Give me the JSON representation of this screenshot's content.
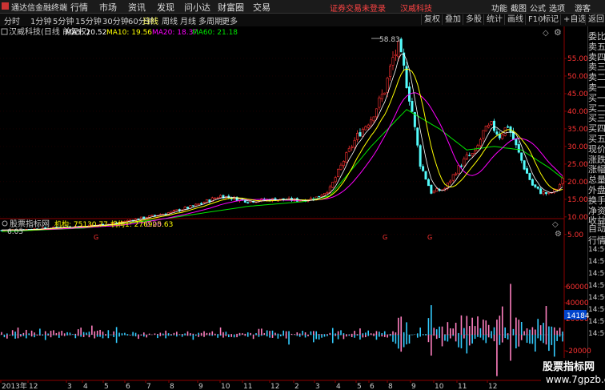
{
  "app": {
    "title": "通达信金融终端",
    "logo_color": "#cc3333"
  },
  "menu": [
    "行情",
    "市场",
    "资讯",
    "发现",
    "问小达",
    "财富圈",
    "交易"
  ],
  "warning": "证券交易未登录",
  "stock_name": "汉威科技",
  "right_menu": [
    "功能",
    "截图",
    "公式",
    "选项",
    "游客"
  ],
  "periods": [
    "分时",
    "1分钟",
    "5分钟",
    "15分钟",
    "30分钟",
    "60分钟",
    "日线",
    "周线",
    "月线",
    "多周期",
    "更多"
  ],
  "active_period": "日线",
  "tool_buttons": [
    "复权",
    "叠加",
    "多股",
    "统计",
    "画线",
    "F10",
    "标记",
    "+自选",
    "返回"
  ],
  "info": {
    "title": "汉威科技(日线 前复权)",
    "ma5": "MA5: 20.52",
    "ma10": "MA10: 19.56",
    "ma20": "MA20: 18.37",
    "ma60": "MA60: 21.18"
  },
  "indicator": {
    "name": "股票指标网",
    "v1": "机构: 75130.77",
    "v2": "机构1: 276925.63",
    "v3": ": 0.00"
  },
  "right_panel": {
    "top": [
      "委比",
      "卖五",
      "卖四",
      "卖三",
      "卖二",
      "卖一",
      "买一",
      "买二",
      "买三",
      "买四",
      "买五",
      "现价",
      "涨跌",
      "涨幅",
      "总量",
      "外盘",
      "换手",
      "净资",
      "收益"
    ],
    "bottom": [
      "自动",
      "行情",
      "14:50",
      "14:50",
      "14:50",
      "14:50",
      "14:50",
      "14:50",
      "14:50",
      "14:50"
    ]
  },
  "price_axis": [
    "55.00",
    "50.00",
    "45.00",
    "40.00",
    "35.00",
    "30.00",
    "25.00",
    "20.00",
    "15.00",
    "10.00",
    "5.00"
  ],
  "indicator_axis": [
    "60000",
    "40000",
    "20000",
    "-20000"
  ],
  "current_label": "14184",
  "max_label": "58.83",
  "min_label": "6.05",
  "x_labels": [
    "2013年",
    "12",
    "3",
    "4",
    "5",
    "6",
    "7",
    "8",
    "9",
    "10",
    "11",
    "12",
    "2",
    "3",
    "4",
    "5",
    "6",
    "8",
    "9",
    "10",
    "11",
    "12"
  ],
  "watermark": {
    "line1": "股票指标网",
    "line2": "www.7gpzb.com"
  },
  "colors": {
    "up": "#ff3232",
    "down": "#54fcfc",
    "ma5": "#ffffff",
    "ma10": "#ffff00",
    "ma20": "#ff00ff",
    "ma60": "#00e600",
    "pink": "#ff7fbf",
    "cyan": "#33ccff"
  },
  "chart_data": {
    "type": "candlestick",
    "ylim": [
      4.5,
      60
    ],
    "price_path": [
      [
        0,
        6.2
      ],
      [
        10,
        6.5
      ],
      [
        20,
        7
      ],
      [
        30,
        7.4
      ],
      [
        40,
        8
      ],
      [
        50,
        9.5
      ],
      [
        60,
        11
      ],
      [
        70,
        13
      ],
      [
        80,
        16
      ],
      [
        90,
        14.5
      ],
      [
        100,
        15
      ],
      [
        110,
        14.7
      ],
      [
        115,
        15.5
      ],
      [
        120,
        18
      ],
      [
        125,
        26
      ],
      [
        130,
        33
      ],
      [
        135,
        38
      ],
      [
        140,
        46
      ],
      [
        143,
        55
      ],
      [
        145,
        58
      ],
      [
        147,
        52
      ],
      [
        150,
        40
      ],
      [
        153,
        25
      ],
      [
        157,
        17
      ],
      [
        162,
        18
      ],
      [
        166,
        23
      ],
      [
        170,
        27
      ],
      [
        173,
        28
      ],
      [
        176,
        34
      ],
      [
        179,
        36
      ],
      [
        182,
        33
      ],
      [
        185,
        36
      ],
      [
        188,
        30
      ],
      [
        191,
        24
      ],
      [
        194,
        19
      ],
      [
        197,
        17
      ],
      [
        200,
        16.5
      ],
      [
        203,
        18
      ],
      [
        205,
        20.5
      ]
    ],
    "ma60_path": [
      [
        0,
        5.8
      ],
      [
        30,
        6.8
      ],
      [
        60,
        9.5
      ],
      [
        90,
        13
      ],
      [
        110,
        14.3
      ],
      [
        120,
        16
      ],
      [
        135,
        30
      ],
      [
        148,
        40.5
      ],
      [
        160,
        35
      ],
      [
        170,
        29
      ],
      [
        180,
        30
      ],
      [
        190,
        29
      ],
      [
        200,
        24
      ],
      [
        205,
        21
      ]
    ]
  }
}
